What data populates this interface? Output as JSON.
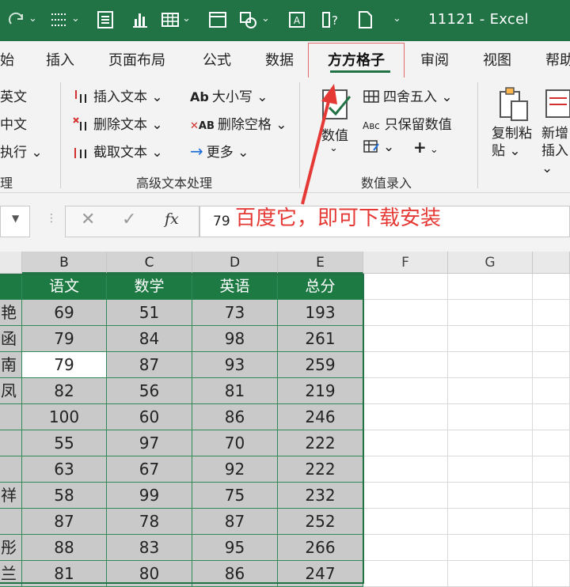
{
  "titlebar": {
    "title": "11121  -  Excel",
    "color": "#217346"
  },
  "tabs": [
    {
      "label": "始"
    },
    {
      "label": "插入"
    },
    {
      "label": "页面布局"
    },
    {
      "label": "公式"
    },
    {
      "label": "数据"
    },
    {
      "label": "方方格子",
      "active": true
    },
    {
      "label": "审阅"
    },
    {
      "label": "视图"
    },
    {
      "label": "帮助"
    }
  ],
  "ribbon": {
    "left_group": {
      "item1": "英文",
      "item2": "中文",
      "item3": "执行 ⌄",
      "label": "理"
    },
    "text_group": {
      "insert_text": "插入文本 ⌄",
      "delete_text": "删除文本 ⌄",
      "cut_text": "截取文本 ⌄",
      "case": "大小写 ⌄",
      "remove_space": "删除空格 ⌄",
      "more": "更多 ⌄",
      "label": "高级文本处理",
      "case_icon": "Ab",
      "space_icon": "AB"
    },
    "number_group": {
      "numeric": "数值",
      "round": "四舍五入 ⌄",
      "keep_numeric": "只保留数值",
      "keep_icon": "Aʙᴄ",
      "label": "数值录入"
    },
    "copy_paste": "复制粘贴 ⌄",
    "new_insert": "新增插入 ⌄"
  },
  "formula_bar": {
    "fx": "fx",
    "value": "79",
    "annotation": "百度它，即可下载安装"
  },
  "columns": [
    "B",
    "C",
    "D",
    "E",
    "F",
    "G"
  ],
  "table": {
    "headers": [
      "语文",
      "数学",
      "英语",
      "总分"
    ],
    "row_label_fragments": [
      "",
      "艳",
      "函",
      "南",
      "凤",
      "",
      "",
      "",
      "祥",
      "",
      "彤",
      "兰"
    ],
    "rows": [
      [
        "69",
        "51",
        "73",
        "193"
      ],
      [
        "79",
        "84",
        "98",
        "261"
      ],
      [
        "79",
        "87",
        "93",
        "259"
      ],
      [
        "82",
        "56",
        "81",
        "219"
      ],
      [
        "100",
        "60",
        "86",
        "246"
      ],
      [
        "55",
        "97",
        "70",
        "222"
      ],
      [
        "63",
        "67",
        "92",
        "222"
      ],
      [
        "58",
        "99",
        "75",
        "232"
      ],
      [
        "87",
        "78",
        "87",
        "252"
      ],
      [
        "88",
        "83",
        "95",
        "266"
      ],
      [
        "81",
        "80",
        "86",
        "247"
      ]
    ]
  }
}
